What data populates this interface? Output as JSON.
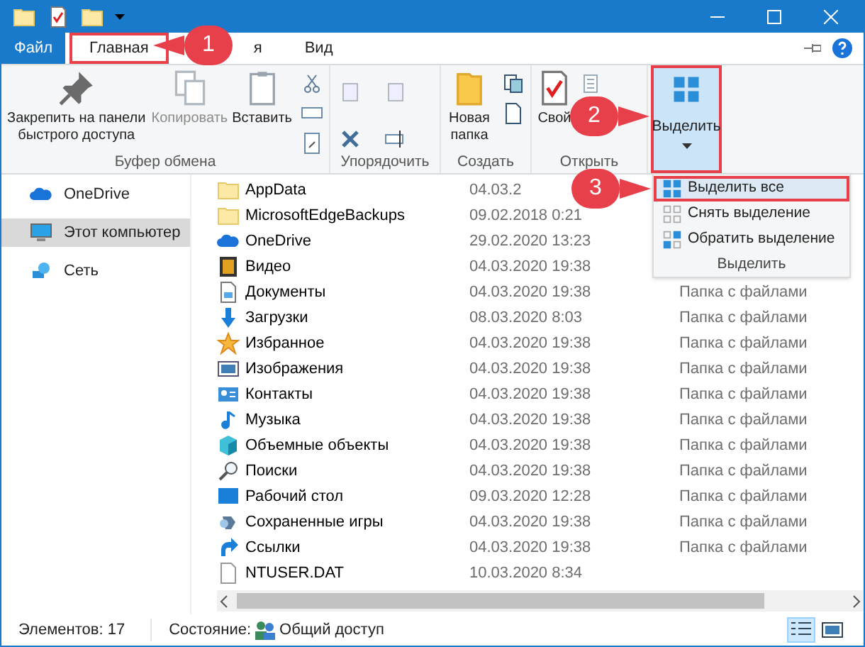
{
  "tabs": [
    {
      "label": "Файл",
      "kind": "file",
      "selected": false
    },
    {
      "label": "Главная",
      "kind": "tab",
      "selected": true
    },
    {
      "label": "я",
      "kind": "tab",
      "selected": false
    },
    {
      "label": "Вид",
      "kind": "tab",
      "selected": false
    }
  ],
  "ribbon": {
    "groups": [
      {
        "label": "Буфер обмена",
        "buttons": [
          {
            "label": "Закрепить на панели быстрого доступа",
            "kind": "pin"
          },
          {
            "label": "Копировать",
            "kind": "copy"
          },
          {
            "label": "Вставить",
            "kind": "paste"
          }
        ],
        "small": [
          {
            "kind": "scissors"
          },
          {
            "kind": "path"
          },
          {
            "kind": "shortcut"
          }
        ]
      },
      {
        "label": "Упорядочить",
        "small": [
          {
            "kind": "move"
          },
          {
            "kind": "delete"
          },
          {
            "kind": "copyto"
          },
          {
            "kind": "rename"
          }
        ]
      },
      {
        "label": "Создать",
        "buttons": [
          {
            "label": "Новая папка",
            "kind": "folder"
          }
        ],
        "small": [
          {
            "kind": "newitem"
          },
          {
            "kind": "easy"
          }
        ]
      },
      {
        "label": "Открыть",
        "buttons": [
          {
            "label": "Свой",
            "kind": "props"
          }
        ],
        "small": [
          {
            "kind": "open"
          }
        ]
      }
    ],
    "select_button": {
      "label": "Выделить",
      "selected": true
    }
  },
  "select_menu": {
    "items": [
      {
        "label": "Выделить все",
        "kind": "all",
        "selected": true
      },
      {
        "label": "Снять выделение",
        "kind": "none",
        "selected": false
      },
      {
        "label": "Обратить выделение",
        "kind": "invert",
        "selected": false
      }
    ],
    "footer": "Выделить"
  },
  "sidebar": {
    "items": [
      {
        "label": "OneDrive",
        "kind": "cloud",
        "selected": false
      },
      {
        "label": "Этот компьютер",
        "kind": "pc",
        "selected": true
      },
      {
        "label": "Сеть",
        "kind": "net",
        "selected": false
      }
    ]
  },
  "files": [
    {
      "name": "AppData",
      "date": "04.03.2",
      "kind": "folderlight"
    },
    {
      "name": "MicrosoftEdgeBackups",
      "date": "09.02.2018 0:21",
      "kind": "folderlight"
    },
    {
      "name": "OneDrive",
      "date": "29.02.2020 13:23",
      "kind": "cloud"
    },
    {
      "name": "Видео",
      "date": "04.03.2020 19:38",
      "kind": "video"
    },
    {
      "name": "Документы",
      "date": "04.03.2020 19:38",
      "type": "Папка с файлами",
      "kind": "doc"
    },
    {
      "name": "Загрузки",
      "date": "08.03.2020 8:03",
      "type": "Папка с файлами",
      "kind": "down"
    },
    {
      "name": "Избранное",
      "date": "04.03.2020 19:38",
      "type": "Папка с файлами",
      "kind": "star"
    },
    {
      "name": "Изображения",
      "date": "04.03.2020 19:38",
      "type": "Папка с файлами",
      "kind": "image"
    },
    {
      "name": "Контакты",
      "date": "04.03.2020 19:38",
      "type": "Папка с файлами",
      "kind": "contact"
    },
    {
      "name": "Музыка",
      "date": "04.03.2020 19:38",
      "type": "Папка с файлами",
      "kind": "music"
    },
    {
      "name": "Объемные объекты",
      "date": "04.03.2020 19:38",
      "type": "Папка с файлами",
      "kind": "cube"
    },
    {
      "name": "Поиски",
      "date": "04.03.2020 19:38",
      "type": "Папка с файлами",
      "kind": "search"
    },
    {
      "name": "Рабочий стол",
      "date": "09.03.2020 12:28",
      "type": "Папка с файлами",
      "kind": "desktop"
    },
    {
      "name": "Сохраненные игры",
      "date": "04.03.2020 19:38",
      "type": "Папка с файлами",
      "kind": "game"
    },
    {
      "name": "Ссылки",
      "date": "04.03.2020 19:38",
      "type": "Папка с файлами",
      "kind": "link"
    },
    {
      "name": "NTUSER.DAT",
      "date": "10.03.2020 8:34",
      "kind": "file"
    }
  ],
  "status_bar": {
    "count": "Элементов: 17",
    "state_label": "Состояние:",
    "state": "Общий доступ",
    "views": [
      {
        "kind": "details",
        "selected": true
      },
      {
        "kind": "tiles",
        "selected": false
      }
    ]
  },
  "callouts": [
    "1",
    "2",
    "3"
  ]
}
